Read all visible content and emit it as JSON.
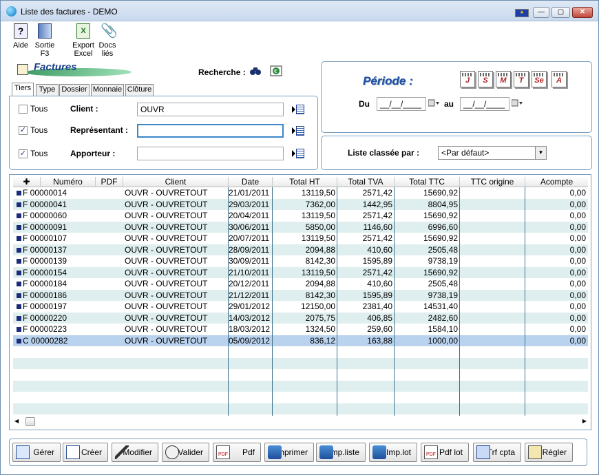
{
  "window": {
    "title": "Liste des factures - DEMO"
  },
  "toolbar": {
    "aide": "Aide",
    "sortie_l1": "Sortie",
    "sortie_l2": "F3",
    "export_l1": "Export",
    "export_l2": "Excel",
    "docs_l1": "Docs",
    "docs_l2": "liés"
  },
  "header": {
    "logo_label": "Factures",
    "recherche_label": "Recherche :"
  },
  "tabs": [
    "Tiers",
    "Type",
    "Dossier",
    "Monnaie",
    "Clôture"
  ],
  "filters": {
    "tous_label": "Tous",
    "client_label": "Client :",
    "client_value": "OUVR",
    "client_tous_checked": false,
    "representant_label": "Représentant :",
    "representant_value": "",
    "representant_tous_checked": true,
    "apporteur_label": "Apporteur :",
    "apporteur_value": "",
    "apporteur_tous_checked": true
  },
  "periode": {
    "title": "Période :",
    "buttons": [
      "J",
      "S",
      "M",
      "T",
      "Se",
      "A"
    ],
    "du_label": "Du",
    "au_label": "au",
    "du_value": "__/__/____",
    "au_value": "__/__/____"
  },
  "sort": {
    "label": "Liste classée par :",
    "value": "<Par défaut>"
  },
  "grid": {
    "columns": [
      "Numéro",
      "PDF",
      "Client",
      "Date",
      "Total HT",
      "Total TVA",
      "Total TTC",
      "TTC origine",
      "Acompte"
    ],
    "rows": [
      [
        "F 00000014",
        "",
        "OUVR - OUVRETOUT",
        "21/01/2011",
        "13119,50",
        "2571,42",
        "15690,92",
        "",
        "0,00"
      ],
      [
        "F 00000041",
        "",
        "OUVR - OUVRETOUT",
        "29/03/2011",
        "7362,00",
        "1442,95",
        "8804,95",
        "",
        "0,00"
      ],
      [
        "F 00000060",
        "",
        "OUVR - OUVRETOUT",
        "20/04/2011",
        "13119,50",
        "2571,42",
        "15690,92",
        "",
        "0,00"
      ],
      [
        "F 00000091",
        "",
        "OUVR - OUVRETOUT",
        "30/06/2011",
        "5850,00",
        "1146,60",
        "6996,60",
        "",
        "0,00"
      ],
      [
        "F 00000107",
        "",
        "OUVR - OUVRETOUT",
        "20/07/2011",
        "13119,50",
        "2571,42",
        "15690,92",
        "",
        "0,00"
      ],
      [
        "F 00000137",
        "",
        "OUVR - OUVRETOUT",
        "28/09/2011",
        "2094,88",
        "410,60",
        "2505,48",
        "",
        "0,00"
      ],
      [
        "F 00000139",
        "",
        "OUVR - OUVRETOUT",
        "30/09/2011",
        "8142,30",
        "1595,89",
        "9738,19",
        "",
        "0,00"
      ],
      [
        "F 00000154",
        "",
        "OUVR - OUVRETOUT",
        "21/10/2011",
        "13119,50",
        "2571,42",
        "15690,92",
        "",
        "0,00"
      ],
      [
        "F 00000184",
        "",
        "OUVR - OUVRETOUT",
        "20/12/2011",
        "2094,88",
        "410,60",
        "2505,48",
        "",
        "0,00"
      ],
      [
        "F 00000186",
        "",
        "OUVR - OUVRETOUT",
        "21/12/2011",
        "8142,30",
        "1595,89",
        "9738,19",
        "",
        "0,00"
      ],
      [
        "F 00000197",
        "",
        "OUVR - OUVRETOUT",
        "29/01/2012",
        "12150,00",
        "2381,40",
        "14531,40",
        "",
        "0,00"
      ],
      [
        "F 00000220",
        "",
        "OUVR - OUVRETOUT",
        "14/03/2012",
        "2075,75",
        "406,85",
        "2482,60",
        "",
        "0,00"
      ],
      [
        "F 00000223",
        "",
        "OUVR - OUVRETOUT",
        "18/03/2012",
        "1324,50",
        "259,60",
        "1584,10",
        "",
        "0,00"
      ],
      [
        "C 00000282",
        "",
        "OUVR - OUVRETOUT",
        "05/09/2012",
        "836,12",
        "163,88",
        "1000,00",
        "",
        "0,00"
      ]
    ],
    "selected_row": 13
  },
  "buttons": [
    "Gérer",
    "Créer",
    "Modifier",
    "Valider",
    "Pdf",
    "Imprimer",
    "Imp.liste",
    "Imp.lot",
    "Pdf lot",
    "Trf cpta",
    "Régler"
  ],
  "colors": {
    "accent": "#3a86c8",
    "row_alt": "#dfeeee",
    "row_selected": "#b9d3ef",
    "frame": "#7b9ebd"
  }
}
